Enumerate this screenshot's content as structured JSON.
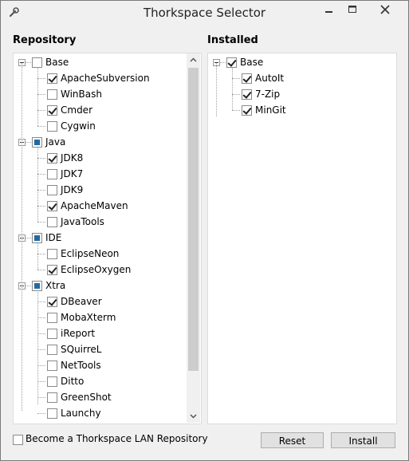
{
  "window": {
    "title": "Thorkspace Selector",
    "icons": {
      "app": "wrench-icon",
      "minimize": "minimize-icon",
      "maximize": "maximize-icon",
      "close": "close-icon"
    }
  },
  "repository": {
    "label": "Repository",
    "groups": [
      {
        "name": "Base",
        "state": "unchecked",
        "items": [
          {
            "name": "ApacheSubversion",
            "checked": true
          },
          {
            "name": "WinBash",
            "checked": false
          },
          {
            "name": "Cmder",
            "checked": true
          },
          {
            "name": "Cygwin",
            "checked": false
          }
        ]
      },
      {
        "name": "Java",
        "state": "partial",
        "items": [
          {
            "name": "JDK8",
            "checked": true
          },
          {
            "name": "JDK7",
            "checked": false
          },
          {
            "name": "JDK9",
            "checked": false
          },
          {
            "name": "ApacheMaven",
            "checked": true
          },
          {
            "name": "JavaTools",
            "checked": false
          }
        ]
      },
      {
        "name": "IDE",
        "state": "partial",
        "items": [
          {
            "name": "EclipseNeon",
            "checked": false
          },
          {
            "name": "EclipseOxygen",
            "checked": true
          }
        ]
      },
      {
        "name": "Xtra",
        "state": "partial",
        "items": [
          {
            "name": "DBeaver",
            "checked": true
          },
          {
            "name": "MobaXterm",
            "checked": false
          },
          {
            "name": "iReport",
            "checked": false
          },
          {
            "name": "SQuirreL",
            "checked": false
          },
          {
            "name": "NetTools",
            "checked": false
          },
          {
            "name": "Ditto",
            "checked": false
          },
          {
            "name": "GreenShot",
            "checked": false
          },
          {
            "name": "Launchy",
            "checked": false
          }
        ]
      }
    ]
  },
  "installed": {
    "label": "Installed",
    "groups": [
      {
        "name": "Base",
        "state": "checked",
        "items": [
          {
            "name": "AutoIt",
            "checked": true
          },
          {
            "name": "7-Zip",
            "checked": true
          },
          {
            "name": "MinGit",
            "checked": true
          }
        ]
      }
    ]
  },
  "footer": {
    "lan_label": "Become a Thorkspace LAN Repository",
    "lan_checked": false,
    "reset_label": "Reset",
    "install_label": "Install"
  }
}
